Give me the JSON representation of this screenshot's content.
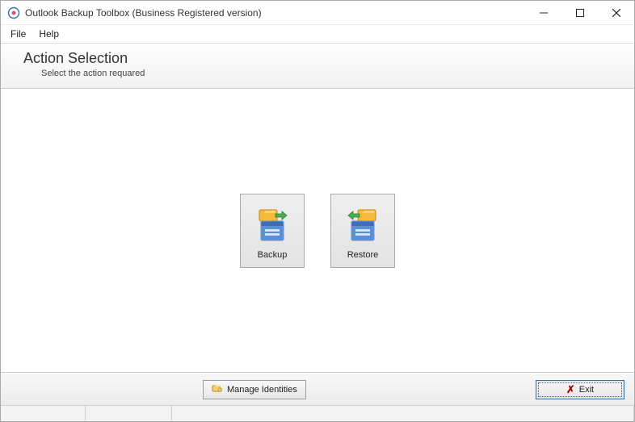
{
  "window": {
    "title": "Outlook Backup Toolbox (Business Registered version)"
  },
  "menu": {
    "file": "File",
    "help": "Help"
  },
  "header": {
    "title": "Action Selection",
    "subtitle": "Select the action requared"
  },
  "actions": {
    "backup_label": "Backup",
    "restore_label": "Restore"
  },
  "footer": {
    "manage_label": "Manage Identities",
    "exit_label": "Exit"
  }
}
